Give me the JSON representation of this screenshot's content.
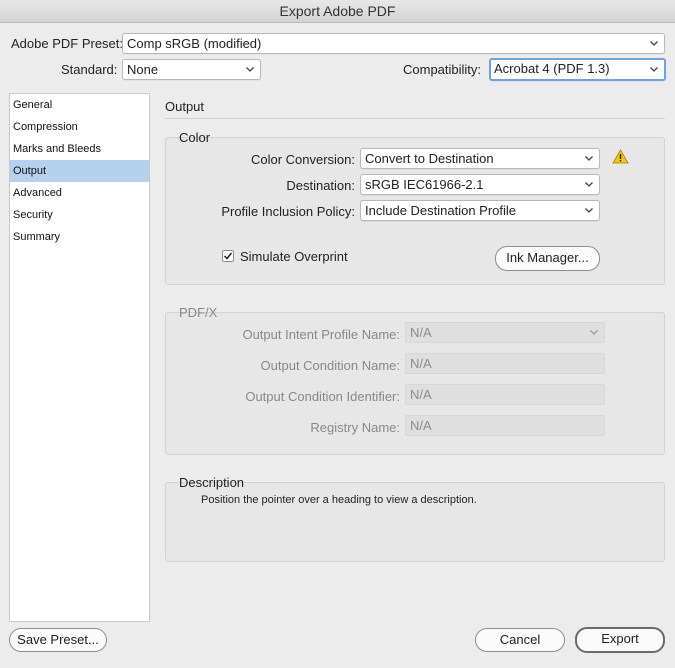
{
  "window": {
    "title": "Export Adobe PDF"
  },
  "header": {
    "preset_label": "Adobe PDF Preset:",
    "preset_value": "Comp sRGB (modified)",
    "standard_label": "Standard:",
    "standard_value": "None",
    "compat_label": "Compatibility:",
    "compat_value": "Acrobat 4 (PDF 1.3)"
  },
  "sidebar": {
    "items": [
      {
        "label": "General"
      },
      {
        "label": "Compression"
      },
      {
        "label": "Marks and Bleeds"
      },
      {
        "label": "Output"
      },
      {
        "label": "Advanced"
      },
      {
        "label": "Security"
      },
      {
        "label": "Summary"
      }
    ],
    "selected": "Output"
  },
  "main": {
    "section_title": "Output",
    "color": {
      "title": "Color",
      "conversion_label": "Color Conversion:",
      "conversion_value": "Convert to Destination",
      "destination_label": "Destination:",
      "destination_value": "sRGB IEC61966-2.1",
      "policy_label": "Profile Inclusion Policy:",
      "policy_value": "Include Destination Profile",
      "simulate_label": "Simulate Overprint",
      "simulate_checked": true,
      "ink_manager_label": "Ink Manager...",
      "warning_icon": "warning-icon"
    },
    "pdfx": {
      "title": "PDF/X",
      "intent_label": "Output Intent Profile Name:",
      "intent_value": "N/A",
      "condition_name_label": "Output Condition Name:",
      "condition_name_value": "N/A",
      "condition_id_label": "Output Condition Identifier:",
      "condition_id_value": "N/A",
      "registry_label": "Registry Name:",
      "registry_value": "N/A"
    },
    "description": {
      "title": "Description",
      "text": "Position the pointer over a heading to view a description."
    }
  },
  "footer": {
    "save_preset_label": "Save Preset...",
    "cancel_label": "Cancel",
    "export_label": "Export"
  },
  "colors": {
    "selection": "#b5d1ee",
    "focus_ring": "#6fa2e0",
    "warning": "#f0c400"
  }
}
